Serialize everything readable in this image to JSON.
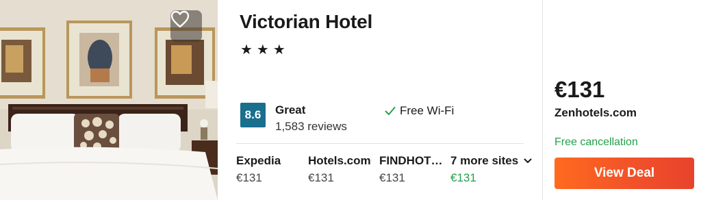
{
  "hotel": {
    "name": "Victorian Hotel",
    "stars": "★★★",
    "star_count": 3,
    "photo_icon": "bedroom-photo",
    "favorite_icon": "heart-outline-icon"
  },
  "rating": {
    "score": "8.6",
    "word": "Great",
    "reviews": "1,583 reviews",
    "badge_color": "#1a6e8e"
  },
  "amenities": [
    {
      "icon": "check-icon",
      "label": "Free Wi-Fi"
    }
  ],
  "sites": [
    {
      "name": "Expedia",
      "price": "€131"
    },
    {
      "name": "Hotels.com",
      "price": "€131"
    },
    {
      "name": "FINDHOT…",
      "price": "€131"
    }
  ],
  "more_sites": {
    "label": "7 more sites",
    "price": "€131",
    "icon": "chevron-down-icon"
  },
  "deal": {
    "price": "€131",
    "site": "Zenhotels.com",
    "cancellation": "Free cancellation",
    "button_label": "View Deal",
    "button_color": "#f0502a",
    "green": "#22a04b"
  }
}
